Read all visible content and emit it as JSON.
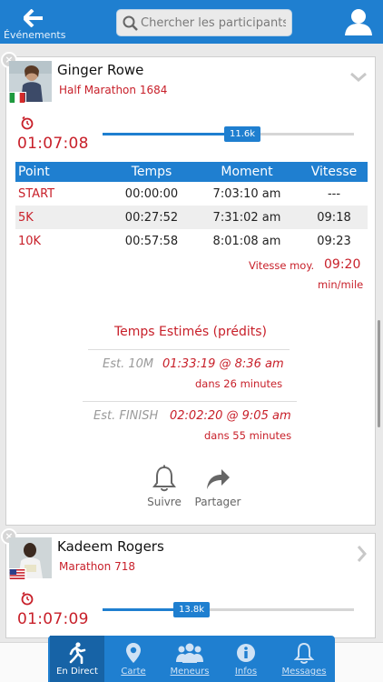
{
  "header": {
    "back_label": "Événements",
    "search_placeholder": "Chercher les participants"
  },
  "participants": [
    {
      "name": "Ginger Rowe",
      "race": "Half Marathon 1684",
      "flag": "italy",
      "clock_time": "01:07:08",
      "distance_badge": "11.6k",
      "progress_fraction": 0.5,
      "splits": {
        "headers": [
          "Point",
          "Temps",
          "Moment",
          "Vitesse"
        ],
        "rows": [
          {
            "point": "START",
            "time": "00:00:00",
            "moment": "7:03:10 am",
            "speed": "---"
          },
          {
            "point": "5K",
            "time": "00:27:52",
            "moment": "7:31:02 am",
            "speed": "09:18"
          },
          {
            "point": "10K",
            "time": "00:57:58",
            "moment": "8:01:08 am",
            "speed": "09:23"
          }
        ]
      },
      "avg_speed_label": "Vitesse moy.",
      "avg_speed_value": "09:20",
      "avg_speed_unit": "min/mile",
      "estimates_title": "Temps Estimés (prédits)",
      "estimates": [
        {
          "label": "Est. 10M",
          "value": "01:33:19 @ 8:36 am",
          "in": "dans 26 minutes"
        },
        {
          "label": "Est. FINISH",
          "value": "02:02:20 @ 9:05 am",
          "in": "dans 55 minutes"
        }
      ],
      "actions": {
        "follow": "Suivre",
        "share": "Partager"
      }
    },
    {
      "name": "Kadeem Rogers",
      "race": "Marathon 718",
      "flag": "usa",
      "clock_time": "01:07:09",
      "distance_badge": "13.8k",
      "progress_fraction": 0.33
    }
  ],
  "tabs": [
    {
      "label": "En Direct",
      "icon": "runner-icon",
      "active": true
    },
    {
      "label": "Carte",
      "icon": "map-pin-icon",
      "active": false
    },
    {
      "label": "Meneurs",
      "icon": "group-icon",
      "active": false
    },
    {
      "label": "Infos",
      "icon": "info-icon",
      "active": false
    },
    {
      "label": "Messages",
      "icon": "bell-icon",
      "active": false
    }
  ],
  "colors": {
    "accent": "#1f7fd0",
    "red": "#c8202a"
  }
}
